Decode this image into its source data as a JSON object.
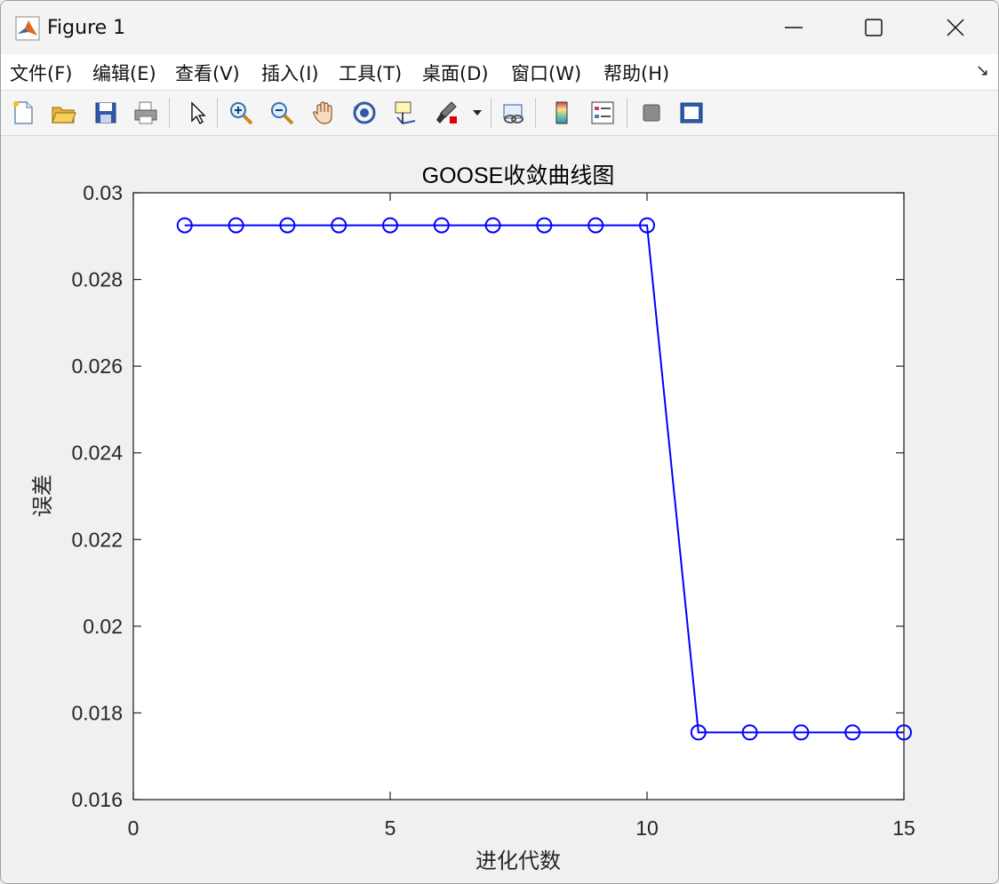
{
  "window": {
    "title": "Figure 1"
  },
  "menu": {
    "items": [
      {
        "label": "文件(F)"
      },
      {
        "label": "编辑(E)"
      },
      {
        "label": "查看(V)"
      },
      {
        "label": "插入(I)"
      },
      {
        "label": "工具(T)"
      },
      {
        "label": "桌面(D)"
      },
      {
        "label": "窗口(W)"
      },
      {
        "label": "帮助(H)"
      }
    ],
    "dock_icon": "↘"
  },
  "toolbar": {
    "icons": [
      "new-figure-icon",
      "open-file-icon",
      "save-icon",
      "print-icon",
      "pointer-icon",
      "zoom-in-icon",
      "zoom-out-icon",
      "pan-icon",
      "rotate-3d-icon",
      "data-cursor-icon",
      "brush-icon",
      "link-plot-icon",
      "colorbar-icon",
      "legend-icon",
      "hide-plot-tools-icon",
      "show-plot-tools-icon"
    ]
  },
  "colors": {
    "series": "#0000ff",
    "axes": "#262626",
    "background": "#f0f0f0"
  },
  "chart_data": {
    "type": "line",
    "title": "GOOSE收敛曲线图",
    "xlabel": "进化代数",
    "ylabel": "误差",
    "xlim": [
      0,
      15
    ],
    "ylim": [
      0.016,
      0.03
    ],
    "xticks": [
      "0",
      "5",
      "10",
      "15"
    ],
    "yticks": [
      "0.016",
      "0.018",
      "0.02",
      "0.022",
      "0.024",
      "0.026",
      "0.028",
      "0.03"
    ],
    "marker": "circle",
    "grid": false,
    "series": [
      {
        "x": [
          1,
          2,
          3,
          4,
          5,
          6,
          7,
          8,
          9,
          10,
          11,
          12,
          13,
          14,
          15
        ],
        "y": [
          0.02925,
          0.02925,
          0.02925,
          0.02925,
          0.02925,
          0.02925,
          0.02925,
          0.02925,
          0.02925,
          0.02925,
          0.01755,
          0.01755,
          0.01755,
          0.01755,
          0.01755
        ]
      }
    ]
  }
}
